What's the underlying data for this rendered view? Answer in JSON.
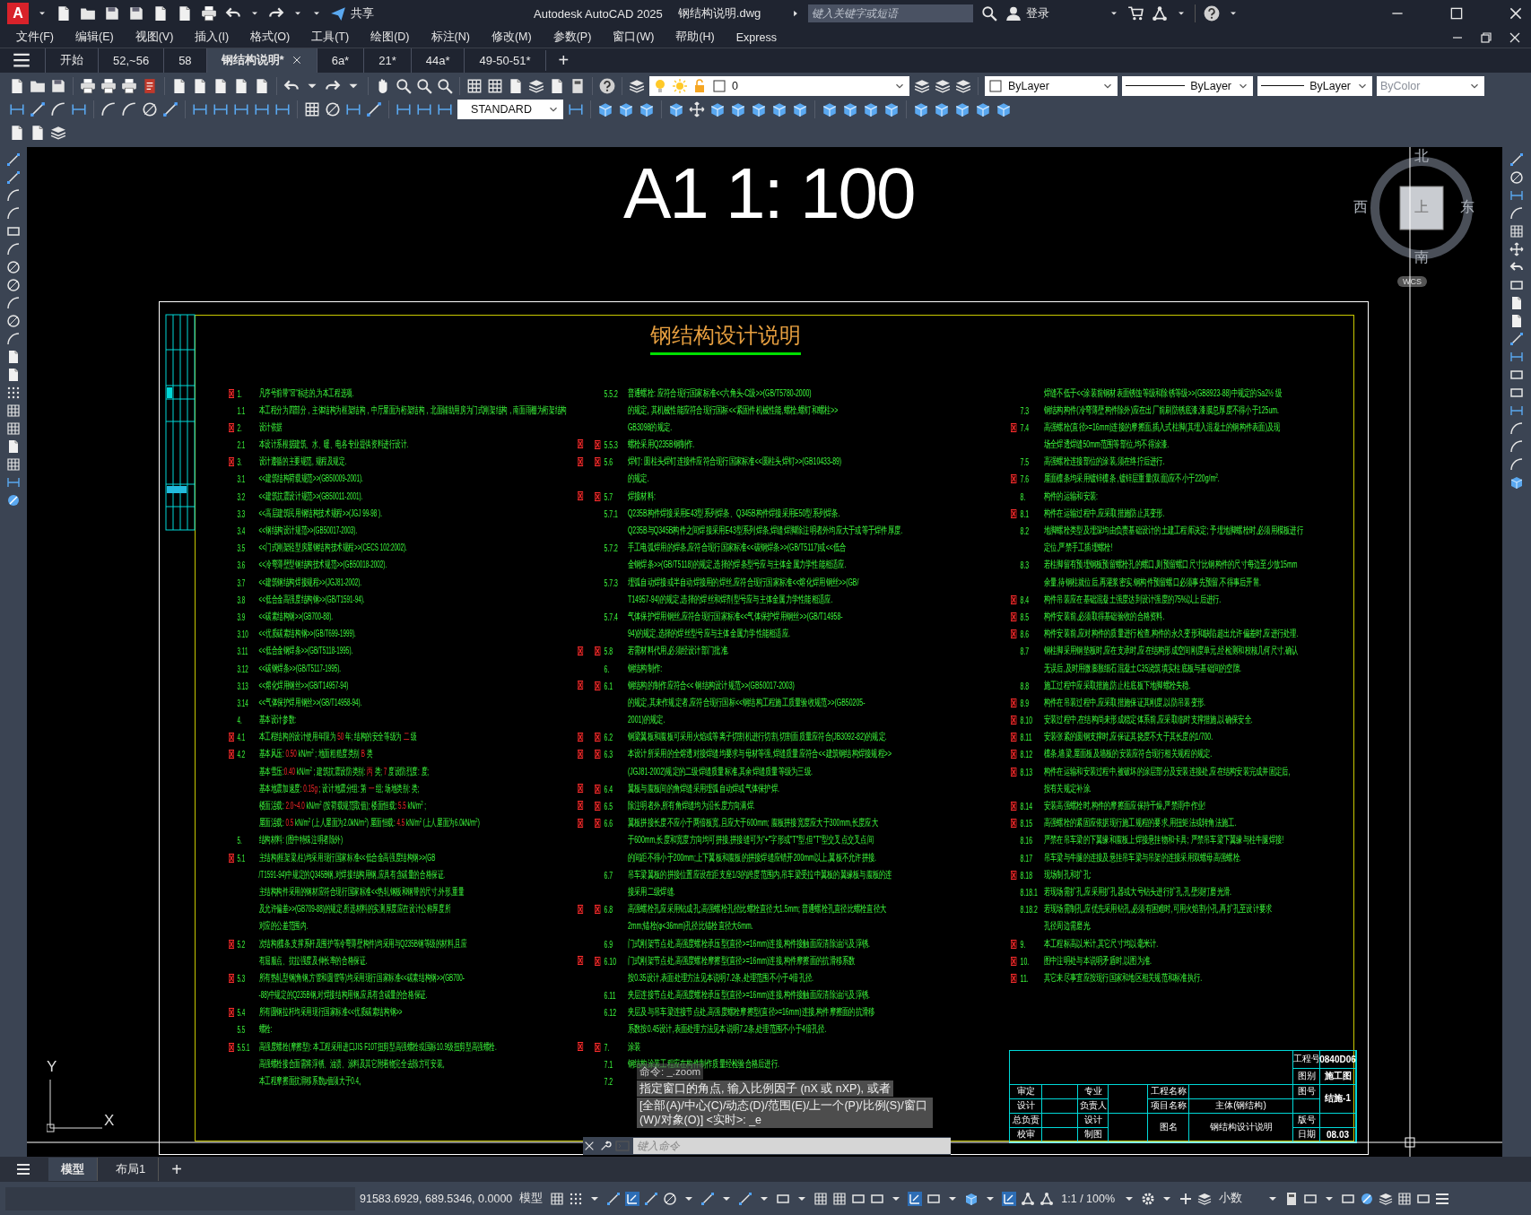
{
  "titlebar": {
    "app_button": "A",
    "share": "共享",
    "title": "Autodesk AutoCAD 2025",
    "file": "钢结构说明.dwg",
    "search": {
      "placeholder": "键入关键字或短语"
    },
    "sign_in": "登录"
  },
  "menu": [
    "文件(F)",
    "编辑(E)",
    "视图(V)",
    "插入(I)",
    "格式(O)",
    "工具(T)",
    "绘图(D)",
    "标注(N)",
    "修改(M)",
    "参数(P)",
    "窗口(W)",
    "帮助(H)",
    "Express"
  ],
  "file_tabs": [
    {
      "label": "开始",
      "selected": false,
      "closable": false
    },
    {
      "label": "52,~56",
      "selected": false,
      "closable": false
    },
    {
      "label": "58",
      "selected": false,
      "closable": false
    },
    {
      "label": "钢结构说明*",
      "selected": true,
      "closable": true
    },
    {
      "label": "6a*",
      "selected": false,
      "closable": false
    },
    {
      "label": "21*",
      "selected": false,
      "closable": false
    },
    {
      "label": "44a*",
      "selected": false,
      "closable": false
    },
    {
      "label": "49-50-51*",
      "selected": false,
      "closable": false
    }
  ],
  "new_tab": "+",
  "toolbar": {
    "layer": "0",
    "object_color": "ByLayer",
    "linetype": "ByLayer",
    "lineweight": "ByLayer",
    "plot_style": {
      "value": "ByColor",
      "disabled": true
    },
    "text_style": "STANDARD"
  },
  "drawing": {
    "scale_label": "A1 1: 100",
    "title": "钢结构设计说明",
    "columns": [
      [
        {
          "num": "1.",
          "text": "凡序号前带\"☒\"标志的,为本工程选项.",
          "marked": true
        },
        {
          "num": "1.1",
          "text": "本工程分为四部分，主体结构为框架结构，中厅屋面为桁架结构，北面辅助用房为门式刚架结构，南面雨棚为桁架结构"
        },
        {
          "num": "2.",
          "text": "设计依据",
          "marked": true
        },
        {
          "num": "2.1",
          "text": "本设计系根据建筑、水、暖、电各专业提供资料进行设计.",
          "end_marked": true
        },
        {
          "num": "3.",
          "text": "设计遵循的主要规范, 规程及规定.",
          "marked": true,
          "end_marked": true
        },
        {
          "num": "3.1",
          "text": "<<建筑结构荷载规范>>(GB50009-2001)."
        },
        {
          "num": "3.2",
          "text": "<<建筑抗震设计规范>>(GB50011-2001).",
          "end_marked": true
        },
        {
          "num": "3.3",
          "text": "<<高层建筑民用钢结构技术规程>>(JGJ 99-98 )."
        },
        {
          "num": "3.4",
          "text": "<<钢结构设计规范>>(GB50017-2003)."
        },
        {
          "num": "3.5",
          "text": "<<门式刚架轻型房屋钢结构技术规程>>(CECS 102:2002)."
        },
        {
          "num": "3.6",
          "text": "<<冷弯薄壁型钢结构技术规范>>(GB50018-2002)."
        },
        {
          "num": "3.7",
          "text": "<<建筑钢结构焊接规程>>(JGJ81-2002)."
        },
        {
          "num": "3.8",
          "text": "<<低合金高强度结构钢>>(GB/T1591-94)."
        },
        {
          "num": "3.9",
          "text": "<<碳素结构钢>>(GB700-88)."
        },
        {
          "num": "3.10",
          "text": "<<优质碳素结构钢>>(GB/T699-1999)."
        },
        {
          "num": "3.11",
          "text": "<<低合金钢焊条>>(GB/T5118-1995).",
          "end_marked": true
        },
        {
          "num": "3.12",
          "text": "<<碳钢焊条>>(GB/T5117-1995)."
        },
        {
          "num": "3.13",
          "text": "<<熔化焊用钢丝>>(GB/T14957-94)",
          "end_marked": true
        },
        {
          "num": "3.14",
          "text": "<<气体保护焊用钢丝>>(GB/T14958-94)."
        },
        {
          "num": "4.",
          "text": "基本设计参数:"
        },
        {
          "num": "4.1",
          "marked": true,
          "end_marked": true,
          "parts": [
            {
              "text": "本工程结构的设计使用年限为 ",
              "value": false
            },
            {
              "text": "50",
              "value": true
            },
            {
              "text": " 年;  结构的安全等级为 ",
              "value": false
            },
            {
              "text": "二",
              "value": true
            },
            {
              "text": " 级",
              "value": false
            }
          ]
        },
        {
          "num": "4.2",
          "marked": true,
          "end_marked": true,
          "parts": [
            {
              "text": "基本风压: ",
              "value": false
            },
            {
              "text": "0.50",
              "value": true
            },
            {
              "text": "  kN/m$^{2}$ ;  地面粗糙度类别 ",
              "value": false
            },
            {
              "text": "B",
              "value": true
            },
            {
              "text": " 类",
              "value": false
            }
          ]
        },
        {
          "parts": [
            {
              "text": "基本雪压:",
              "value": false
            },
            {
              "text": "0.40",
              "value": true
            },
            {
              "text": "  kN/m$^{2}$ ;  建筑抗震设防类别: ",
              "value": false
            },
            {
              "text": "丙",
              "value": true
            },
            {
              "text": " 类; ",
              "value": false
            },
            {
              "text": "7",
              "value": true
            },
            {
              "text": " 度设防烈度:    度;",
              "value": false
            }
          ]
        },
        {
          "end_marked": true,
          "parts": [
            {
              "text": "基本地震加速度: ",
              "value": false
            },
            {
              "text": "0.15g",
              "value": true
            },
            {
              "text": "  ;  设计地震分组: 第 ",
              "value": false
            },
            {
              "text": "一",
              "value": true
            },
            {
              "text": " 组;  场地类别:     类;",
              "value": false
            }
          ]
        },
        {
          "end_marked": true,
          "parts": [
            {
              "text": "楼面活载: ",
              "value": false
            },
            {
              "text": "2.0~4.0",
              "value": true
            },
            {
              "text": "  kN/m$^{2}$ (按荷载规范取值);  楼面恒载: ",
              "value": false
            },
            {
              "text": "5.5",
              "value": true
            },
            {
              "text": "  kN/m$^{2}$ ;",
              "value": false
            }
          ]
        },
        {
          "end_marked": true,
          "parts": [
            {
              "text": "屋面活载: ",
              "value": false
            },
            {
              "text": "0.5",
              "value": true
            },
            {
              "text": "  kN/m$^{2}$ (上人屋面为2.0kN/m$^{2}$) 屋面恒载: ",
              "value": false
            },
            {
              "text": "4.5",
              "value": true
            },
            {
              "text": "  kN/m$^{2}$ (上人屋面为6.0kN/m$^{2}$)",
              "value": false
            }
          ]
        },
        {
          "num": "5.",
          "text": "结构材料: (图中特殊注明者除外)"
        },
        {
          "num": "5.1",
          "text": "主结构(框架梁,柱)均采用现行国家标准<<低合金高强度结构钢>>(GB",
          "marked": true
        },
        {
          "text": "/T1591-94)中规定的Q345B钢,对焊接结构用钢,应具有含碳量的合格保证."
        },
        {
          "text": "主结构构件采用的钢材应符合现行国家标准<<热轧钢板和钢带的尺寸,外形,重量"
        },
        {
          "text": "及允许偏差>>(GB709-88)的规定.所选材料的实测厚度应在设计公称厚度所",
          "end_marked": true
        },
        {
          "text": "对应的公差范围内."
        },
        {
          "num": "5.2",
          "text": "次结构(檩条,支撑系杆及围护等冷弯薄壁构件)均采用与Q235B钢等级的材料,且应",
          "marked": true
        },
        {
          "text": "有屈服点、抗拉强度及伸长率的合格保证.",
          "end_marked": true
        },
        {
          "num": "5.3",
          "text": "所有热轧型钢(角钢,方管和圆管等)均采用现行国家标准<<碳素结构钢>>(GB700-",
          "marked": true
        },
        {
          "text": "-88)中规定的Q235B钢,对焊接结构用钢,应具有含碳量的合格保证."
        },
        {
          "num": "5.4",
          "text": "所有圆钢拉杆均采用现行国家标准<<优质碳素结构钢>>",
          "marked": true
        },
        {
          "num": "5.5",
          "text": "螺栓:"
        },
        {
          "num": "5.5.1",
          "text": "高强度螺栓(摩擦型): 本工程采用进口JIS F10T扭剪型高强螺栓或国标10.9级扭剪型高强螺栓.",
          "marked": true,
          "end_marked": true
        },
        {
          "text": "高强螺栓接合面需将浮锈、油渍、涂料及其它附着物完全去除方可安装。"
        },
        {
          "text": "本工程摩擦面抗滑移系数μ值须大于0.4。"
        }
      ],
      [
        {
          "num": "5.5.2",
          "text": "普通螺栓: 应符合现行国家标准<<六角头-C级>>(GB/T5780-2000)"
        },
        {
          "text": "的规定, 其机械性能应符合现行国标<<紧固件机械性能,螺栓,螺钉和螺柱>>"
        },
        {
          "text": "GB3098的规定."
        },
        {
          "num": "5.5.3",
          "text": "螺栓采用Q235B钢制作.",
          "marked": true
        },
        {
          "num": "5.6",
          "text": "焊钉: 圆柱头焊钉连接件应符合现行国家标准<<圆柱头焊钉>>(GB10433-89)",
          "marked": true
        },
        {
          "text": "的规定."
        },
        {
          "num": "5.7",
          "text": "焊接材料:",
          "marked": true
        },
        {
          "num": "5.7.1",
          "text": "Q235B构件焊接采用E43型系列焊条、Q345B构件焊接采用E50型系列焊条."
        },
        {
          "text": "Q235B与Q345B构件之间焊接采用E43型系列焊条,焊缝焊脚除注明者外均应大于或等于焊件厚度."
        },
        {
          "num": "5.7.2",
          "text": "手工电弧焊用的焊条,应符合现行国家标准<<碳钢焊条>>(GB/T5117)或<<低合"
        },
        {
          "text": "金钢焊条>>(GB/T5118)的规定,选择的焊条型号应与主体金属力学性能相适应."
        },
        {
          "num": "5.7.3",
          "text": "埋弧自动焊接或半自动焊接用的焊丝,应符合现行国家标准<<熔化焊用钢丝>>(GB/"
        },
        {
          "text": "T14957-94)的规定,选择的焊丝和焊剂型号应与主体金属力学性能相适应."
        },
        {
          "num": "5.7.4",
          "text": "气体保护焊用钢丝,应符合现行国家标准<<气体保护焊用钢丝>>(GB/T14958-"
        },
        {
          "text": "94)的规定,选择的焊丝型号应与主体金属力学性能相适应."
        },
        {
          "num": "5.8",
          "text": "若需材料代用,必须经设计部门批准.",
          "marked": true
        },
        {
          "num": "6.",
          "text": "钢结构制作:"
        },
        {
          "num": "6.1",
          "text": "钢结构的制作应符合<<  钢结构设计规范>>(GB50017-2003)",
          "marked": true
        },
        {
          "text": "的规定,其未作规定者,应符合现行国标<<钢结构工程施工质量验收规范>>(GB50205-"
        },
        {
          "text": "2001)的规定."
        },
        {
          "num": "6.2",
          "text": "钢梁翼板和腹板可采用火焰或等离子切割机进行切割,切割面质量应符合(JB3092-82)的规定.",
          "marked": true
        },
        {
          "num": "6.3",
          "text": "本设计所采用的全熔透对接焊缝均要求与母材等强,焊缝质量应符合<<建筑钢结构焊接规程>>",
          "marked": true
        },
        {
          "text": "(JGJ81-2002)规定的二级焊缝质量标准,其余焊缝质量等级为三级."
        },
        {
          "num": "6.4",
          "text": "翼板与腹板间的角焊缝采用埋弧自动焊或气体保护焊.",
          "marked": true
        },
        {
          "num": "6.5",
          "text": "除注明者外,所有角焊缝均为沿长度方向满焊.",
          "marked": true
        },
        {
          "num": "6.6",
          "text": "翼板拼接长度不应小于两倍板宽,且应大于600mm; 腹板拼接宽度应大于300mm,长度应大",
          "marked": true
        },
        {
          "text": "于600mm,长度和宽度方向均可拼接,拼接缝可为\"+\"字形或\"T\"型,但\"T\"型交叉点交叉点间"
        },
        {
          "text": "的间距不得小于200mm;上下翼板和腹板的拼接焊缝应错开200mm以上,翼板不允许拼接."
        },
        {
          "num": "6.7",
          "text": "吊车梁翼板的拼接位置应设在距支座1/3的跨度范围内,吊车梁受拉中翼板的翼缘板与腹板的连"
        },
        {
          "text": "接采用二级焊缝."
        },
        {
          "num": "6.8",
          "text": "高强螺栓孔应采用钻成孔;高强螺栓孔径比螺栓直径大1.5mm; 普通螺栓孔直径比螺栓直径大",
          "marked": true
        },
        {
          "text": "2mm;锚栓(φ<36mm)孔径比锚栓直径大6mm."
        },
        {
          "num": "6.9",
          "text": "门式刚架节点处,高强度螺栓承压型(直径>=16mm)连接,构件接触面应清除油污及浮锈."
        },
        {
          "num": "6.10",
          "text": "门式刚架节点处,高强度螺栓摩擦型(直径>=16mm)连接,构件摩擦面的抗滑移系数",
          "marked": true
        },
        {
          "text": "按0.35设计,表面处理方法见本说明7.2条,处理范围不小于4倍孔径."
        },
        {
          "num": "6.11",
          "text": "夹层连接节点处,高强度螺栓承压型(直径>=16mm)连接,构件接触面应清除油污及浮锈."
        },
        {
          "num": "6.12",
          "text": "夹层及与吊车梁连接节点处,高强度螺栓摩擦型(直径>=16mm)连接,构件摩擦面的抗滑移"
        },
        {
          "text": "系数按0.45设计,表面处理方法见本说明7.2条,处理范围不小于4倍孔径."
        },
        {
          "num": "7.",
          "text": "涂装",
          "marked": true
        },
        {
          "num": "7.1",
          "text": "钢结构涂装工程应在构件制作质量经检验合格后进行."
        },
        {
          "num": "7.2"
        }
      ],
      [
        {
          "text": "焊缝不低于<<涂装前钢材表面锈蚀等级和除锈等级>>(GB8923-88)中规定的Sa2½  级"
        },
        {
          "num": "7.3",
          "text": "钢结构构件(冷弯薄壁构件除外)应在出厂前刷防锈底漆,漆膜总厚度不得小于125um."
        },
        {
          "num": "7.4",
          "text": "高强螺栓(直径>=16mm)连接的摩擦面,插入式柱脚(其埋入混凝土的钢构件表面)及现",
          "marked": true
        },
        {
          "text": "场全焊透焊缝50mm范围等部位,均不得涂漆."
        },
        {
          "num": "7.5",
          "text": "高强螺栓连接部位的涂装,须在终拧后进行."
        },
        {
          "num": "7.6",
          "text": "屋面檩条均采用镀锌檩条 ,镀锌层重量(双面)应不小于220g/m$^{2}$.",
          "marked": true
        },
        {
          "num": "8.",
          "text": "构件的运输和安装:"
        },
        {
          "num": "8.1",
          "text": "构件在运输过程中,应采取措施防止其变形.",
          "marked": true
        },
        {
          "num": "8.2",
          "text": "地脚螺栓类型及埋深均由负责基础设计的土建工程师决定; 予埋地脚螺栓时,必须用模板进行"
        },
        {
          "text": "定位,严禁手工插埋螺栓!"
        },
        {
          "num": "8.3",
          "text": "若柱脚留有预埋钢板预留螺栓孔的螺口,则预留螺口尺寸比钢构件的尺寸每边至少放15mm"
        },
        {
          "text": "余量,待钢柱就位后,再灌浆密实.钢构件预留螺口必须事先预留,不得事后开凿."
        },
        {
          "num": "8.4",
          "text": "构件吊装应在基础混凝土强度达到设计强度的75%以上后进行.",
          "marked": true
        },
        {
          "num": "8.5",
          "text": "构件安装前,必须取得基础验收的合格资料.",
          "marked": true
        },
        {
          "num": "8.6",
          "text": "构件安装前,应对构件的质量进行检查,构件的永久变形和缺陷超出允许偏差时,应进行处理.",
          "marked": true
        },
        {
          "num": "8.7",
          "text": "钢柱脚采用钢垫板时,应在支承时,应在结构形成空间刚度单元,经检测和校核几何尺寸,确认"
        },
        {
          "text": "无误后,及时用微膨胀细石混凝土C35浇筑填实柱底板与基础间的空隙."
        },
        {
          "num": "8.8",
          "text": "施工过程中应采取措施,防止柱底板下地脚螺栓失稳."
        },
        {
          "num": "8.9",
          "text": "构件在吊装过程中,应采取措施保证其刚度,以防吊装变形.",
          "marked": true
        },
        {
          "num": "8.10",
          "text": "安装过程中,在结构尚未形成稳定体系前,应采取临时支撑措施,以确保安全.",
          "marked": true
        },
        {
          "num": "8.11",
          "text": "安装张紧的圆钢支撑时,应保证其挠度不大于其长度的1/700.",
          "marked": true
        },
        {
          "num": "8.12",
          "text": "檩条,墙梁,屋面板及墙板的安装应符合现行相关规程的规定.",
          "marked": true
        },
        {
          "num": "8.13",
          "text": "构件在运输和安装过程中,被破坏的涂层部分及安装连接处,应在结构安装完成并固定后,",
          "marked": true
        },
        {
          "text": "按有关规定补涂."
        },
        {
          "num": "8.14",
          "text": "安装高强螺栓时,构件的摩擦面应保持干燥,严禁雨中作业!",
          "marked": true
        },
        {
          "num": "8.15",
          "text": "高强螺栓的紧固应依据现行施工规程的要求,用扭矩法或转角法施工.",
          "marked": true
        },
        {
          "num": "8.16",
          "text": "严禁在吊车梁的下翼缘和腹板上焊接悬挂物和卡具; 严禁吊车梁下翼缘与柱牛腿焊接!"
        },
        {
          "num": "8.17",
          "text": "吊车梁与牛腿的连接及悬挂吊车梁与吊架的连接采用双螺母高强螺栓."
        },
        {
          "num": "8.18",
          "text": "现场制孔和扩孔:",
          "marked": true
        },
        {
          "num": "8.18.1",
          "text": "若现场需扩孔,应采用扩孔器或大号钻头进行扩孔,孔壁须打磨光滑."
        },
        {
          "num": "8.18.2",
          "text": "若现场需制孔,应优先采用钻孔,必须有困难时,可用火焰割小孔,再扩孔至设计要求"
        },
        {
          "text": "孔径周边需磨光."
        },
        {
          "num": "9.",
          "text": "本工程标高以米计,其它尺寸均以毫米计.",
          "marked": true
        },
        {
          "num": "10.",
          "text": "图中注明处与本说明矛盾时,以图为准.",
          "marked": true
        },
        {
          "num": "11.",
          "text": "其它未尽事宜应按现行国家和地区相关规范和标准执行.",
          "marked": true
        }
      ]
    ],
    "title_block": {
      "project_no_label": "工程号",
      "project_no": "0840D06",
      "category_label": "图别",
      "category": "施工图",
      "approver_label": "审定",
      "discipline_label": "专业",
      "lead_label": "负责人",
      "project_label": "工程名称",
      "drawing_no_label": "图号",
      "drawing_no": "结施-1",
      "designer_label": "设计",
      "item_label": "项目名称",
      "item": "主体(钢结构)",
      "chief_label": "总负责",
      "designer2_label": "设计",
      "version_label": "版号",
      "checker_label": "校审",
      "drafter_label": "制图",
      "title_label": "图名",
      "title": "钢结构设计说明",
      "date_label": "日期",
      "date": "08.03"
    },
    "viewcube": {
      "north": "北",
      "south": "南",
      "east": "东",
      "west": "西",
      "top": "上",
      "wcs": "WCS"
    },
    "ucs": {
      "x": "X",
      "y": "Y"
    }
  },
  "command_history": [
    "命令:  _.zoom",
    "指定窗口的角点, 输入比例因子 (nX 或 nXP), 或者",
    "[全部(A)/中心(C)/动态(D)/范围(E)/上一个(P)/比例(S)/窗口(W)/对象(O)] <实时>:  _e"
  ],
  "command_line": {
    "placeholder": "键入命令"
  },
  "layout_tabs": [
    {
      "label": "模型",
      "selected": true
    },
    {
      "label": "布局1",
      "selected": false
    }
  ],
  "new_layout": "+",
  "status_bar": {
    "coordinates": "91583.6929, 689.5346, 0.0000",
    "space": "模型",
    "annotation_scale": "1:1 / 100%",
    "units": "小数"
  }
}
